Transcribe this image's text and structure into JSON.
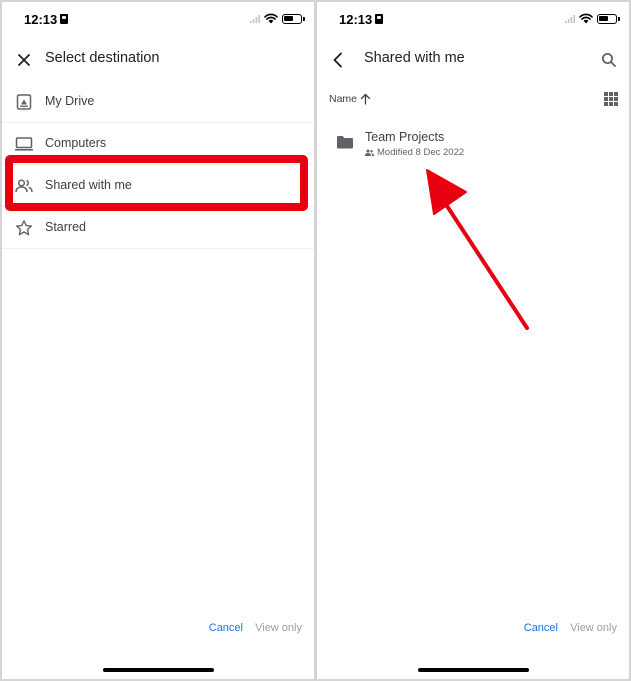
{
  "left_panel": {
    "status_bar": {
      "time": "12:13"
    },
    "app_bar": {
      "title": "Select destination",
      "close_icon": "close-icon"
    },
    "destinations": [
      {
        "label": "My Drive",
        "icon": "drive-icon"
      },
      {
        "label": "Computers",
        "icon": "computer-icon"
      },
      {
        "label": "Shared with me",
        "icon": "people-icon",
        "highlighted": true
      },
      {
        "label": "Starred",
        "icon": "star-icon"
      }
    ],
    "actions": {
      "cancel": "Cancel",
      "view_only": "View only"
    }
  },
  "right_panel": {
    "status_bar": {
      "time": "12:13"
    },
    "app_bar": {
      "title": "Shared with me",
      "back_icon": "back-arrow-icon",
      "search_icon": "search-icon"
    },
    "sort": {
      "label": "Name",
      "direction_icon": "arrow-up-icon",
      "view_icon": "grid-view-icon"
    },
    "files": [
      {
        "name": "Team Projects",
        "meta": "Modified 8 Dec 2022",
        "icon": "folder-icon",
        "shared_icon": "people-icon"
      }
    ],
    "actions": {
      "cancel": "Cancel",
      "view_only": "View only"
    }
  },
  "colors": {
    "accent_blue": "#1a73e8",
    "highlight_red": "#e8000f",
    "text_primary": "#202124",
    "text_secondary": "#5f6368",
    "disabled": "#9aa0a6"
  }
}
